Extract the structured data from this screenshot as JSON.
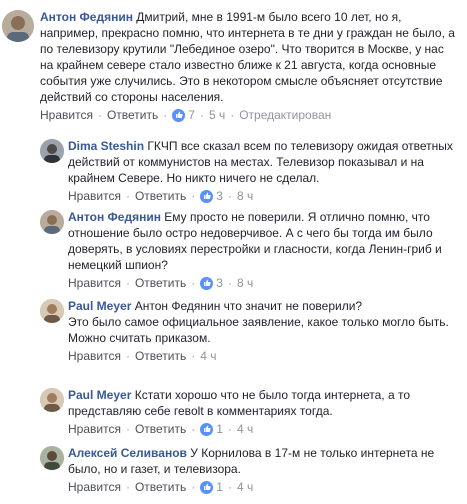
{
  "actions": {
    "like": "Нравится",
    "reply": "Ответить",
    "separator": "·"
  },
  "comments": [
    {
      "author": "Антон Федянин",
      "text": "Дмитрий, мне в 1991-м было всего 10 лет, но я, например, прекрасно помню, что интернета в те дни у граждан не было, а по телевизору крутили \"Лебединое озеро\". Что творится в Москве, у нас на крайнем севере стало известно ближе к 21 августа, когда основные события уже случились. Это в некотором смысле объясняет отсутствие действий со стороны населения.",
      "likes": "7",
      "time": "5 ч",
      "edited": "Отредактирован"
    },
    {
      "author": "Dima Steshin",
      "text": "ГКЧП все сказал всем по телевизору ожидая ответных действий от коммунистов на местах. Телевизор показывал и на крайнем Севере. Но никто ничего не сделал.",
      "likes": "3",
      "time": "8 ч"
    },
    {
      "author": "Антон Федянин",
      "text": "Ему просто не поверили. Я отлично помню, что отношение было остро недоверчивое. А с чего бы тогда им было доверять, в условиях перестройки и гласности, когда Ленин-гриб и немецкий шпион?",
      "likes": "3",
      "time": "8 ч"
    },
    {
      "author": "Paul Meyer",
      "text": "Антон Федянин что значит не поверили?\nЭто было самое официальное заявление, какое только могло быть.\nМожно считать приказом.",
      "time": "4 ч"
    },
    {
      "author": "Paul Meyer",
      "text": "Кстати хорошо что не было тогда интернета, а то представляю себе гевolt в комментариях тогда.",
      "likes": "1",
      "time": "4 ч"
    },
    {
      "author": "Алексей Селиванов",
      "text": "У Корнилова в 17-м не только интернета не было, но и газет, и телевизора.",
      "likes": "1",
      "time": "4 ч"
    }
  ]
}
